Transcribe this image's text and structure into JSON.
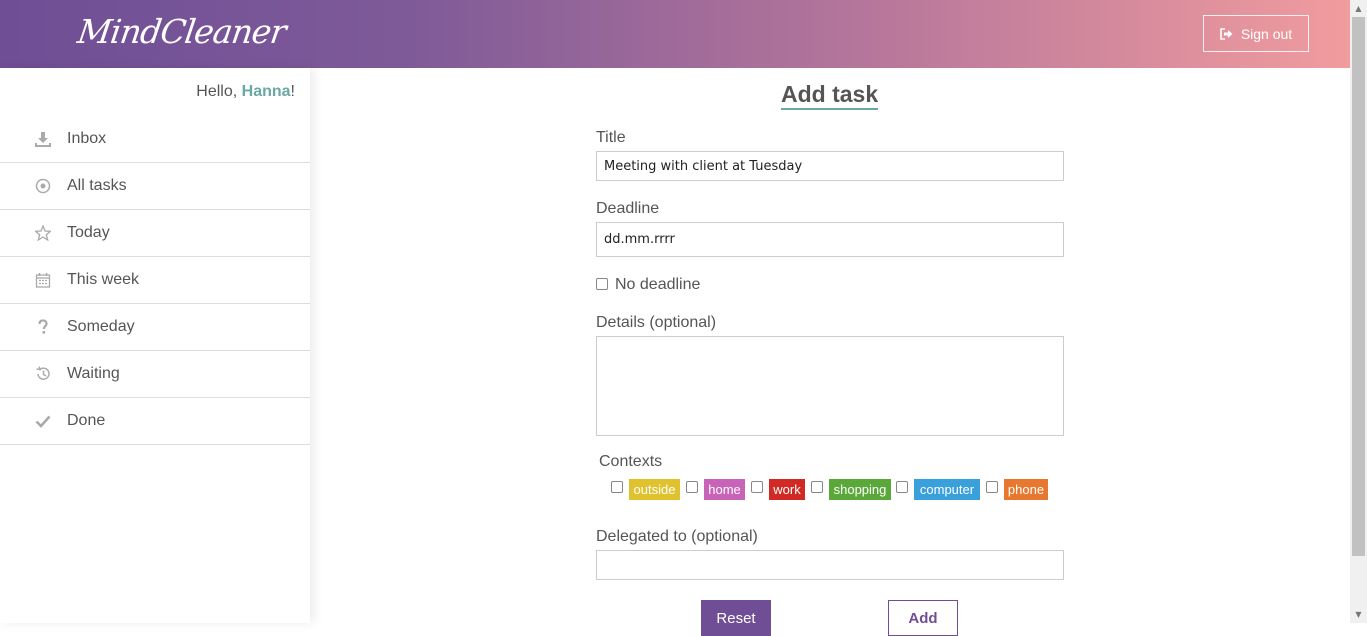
{
  "header": {
    "logo": "MindCleaner",
    "signout_label": "Sign out"
  },
  "sidebar": {
    "greeting_prefix": "Hello, ",
    "user_name": "Hanna",
    "greeting_suffix": "!",
    "items": [
      {
        "label": "Inbox",
        "icon": "download-icon"
      },
      {
        "label": "All tasks",
        "icon": "circle-dot-icon"
      },
      {
        "label": "Today",
        "icon": "star-icon"
      },
      {
        "label": "This week",
        "icon": "calendar-icon"
      },
      {
        "label": "Someday",
        "icon": "question-icon"
      },
      {
        "label": "Waiting",
        "icon": "history-icon"
      },
      {
        "label": "Done",
        "icon": "check-icon"
      }
    ]
  },
  "form": {
    "title": "Add task",
    "title_label": "Title",
    "title_value": "Meeting with client at Tuesday",
    "deadline_label": "Deadline",
    "deadline_value": "dd.mm.rrrr",
    "no_deadline_label": "No deadline",
    "details_label": "Details (optional)",
    "details_value": "",
    "contexts_label": "Contexts",
    "contexts": [
      {
        "label": "outside",
        "color": "#e0c22e"
      },
      {
        "label": "home",
        "color": "#c963b8"
      },
      {
        "label": "work",
        "color": "#d12a24"
      },
      {
        "label": "shopping",
        "color": "#5aa83a"
      },
      {
        "label": "computer",
        "color": "#3aa0dc"
      },
      {
        "label": "phone",
        "color": "#e8772f"
      }
    ],
    "delegated_label": "Delegated to (optional)",
    "delegated_value": "",
    "reset_label": "Reset",
    "add_label": "Add"
  },
  "colors": {
    "accent": "#6f4e96",
    "teal": "#6aa8a5"
  }
}
